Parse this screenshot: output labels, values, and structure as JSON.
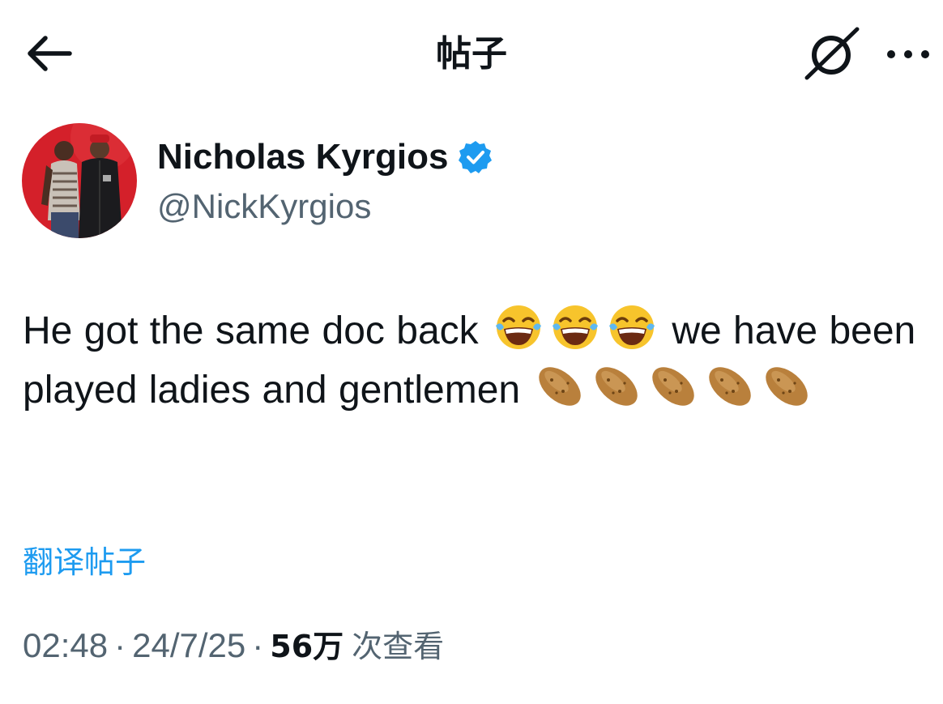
{
  "header": {
    "title": "帖子",
    "back_icon": "arrow-left-icon",
    "grok_icon": "grok-slash-icon",
    "more_icon": "more-dots-icon"
  },
  "author": {
    "name": "Nicholas Kyrgios",
    "handle": "@NickKyrgios",
    "verified": true,
    "verified_color": "#1d9bf0"
  },
  "post": {
    "text_part1": "He got the same doc back",
    "laugh_emoji_count": 3,
    "text_part2": "we have been played ladies and gentlemen",
    "potato_emoji_count": 5,
    "translate_label": "翻译帖子"
  },
  "meta": {
    "time": "02:48",
    "separator": "·",
    "date": "24/7/25",
    "views_count": "56万",
    "views_label": "次查看"
  },
  "colors": {
    "text": "#0f1419",
    "secondary": "#536471",
    "link": "#1d9bf0"
  }
}
